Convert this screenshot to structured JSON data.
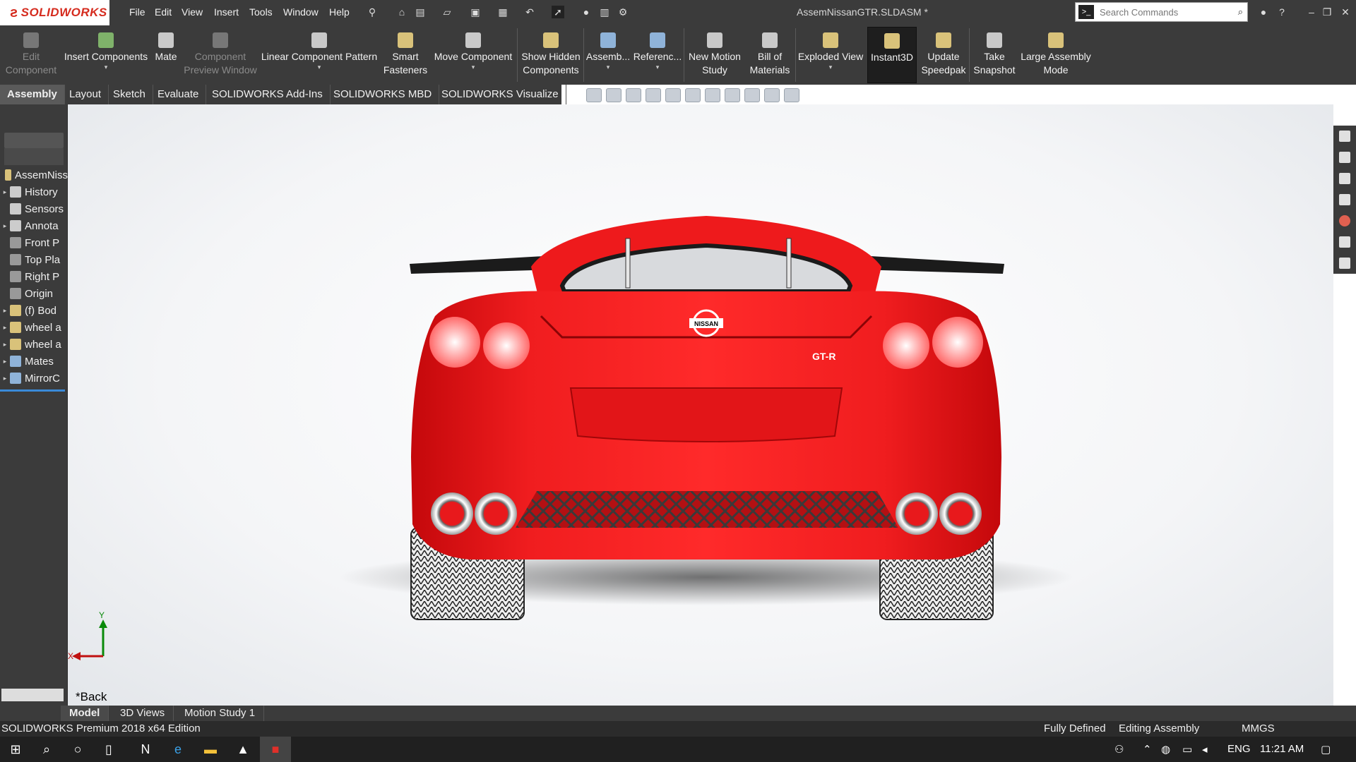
{
  "window": {
    "brand": "SOLIDWORKS",
    "doc_title": "AssemNissanGTR.SLDASM *",
    "menu": [
      "File",
      "Edit",
      "View",
      "Insert",
      "Tools",
      "Window",
      "Help"
    ],
    "search_placeholder": "Search Commands"
  },
  "ribbon": {
    "buttons": [
      {
        "label": "Edit\nComponent",
        "disabled": true,
        "icon": "edit-component-icon"
      },
      {
        "label": "Insert Components",
        "disabled": false,
        "icon": "insert-components-icon"
      },
      {
        "label": "Mate",
        "disabled": false,
        "icon": "mate-icon"
      },
      {
        "label": "Component\nPreview Window",
        "disabled": true,
        "icon": "preview-window-icon"
      },
      {
        "label": "Linear Component Pattern",
        "disabled": false,
        "icon": "linear-pattern-icon"
      },
      {
        "label": "Smart\nFasteners",
        "disabled": false,
        "icon": "smart-fasteners-icon"
      },
      {
        "label": "Move Component",
        "disabled": false,
        "icon": "move-component-icon"
      },
      {
        "label": "Show Hidden\nComponents",
        "disabled": false,
        "icon": "show-hidden-icon"
      },
      {
        "label": "Assemb...",
        "disabled": false,
        "icon": "assembly-features-icon"
      },
      {
        "label": "Referenc...",
        "disabled": false,
        "icon": "reference-geometry-icon"
      },
      {
        "label": "New Motion\nStudy",
        "disabled": false,
        "icon": "motion-study-icon"
      },
      {
        "label": "Bill of\nMaterials",
        "disabled": false,
        "icon": "bill-of-materials-icon"
      },
      {
        "label": "Exploded View",
        "disabled": false,
        "icon": "exploded-view-icon"
      },
      {
        "label": "Instant3D",
        "disabled": false,
        "icon": "instant3d-icon"
      },
      {
        "label": "Update\nSpeedpak",
        "disabled": false,
        "icon": "speedpak-icon"
      },
      {
        "label": "Take\nSnapshot",
        "disabled": false,
        "icon": "camera-icon"
      },
      {
        "label": "Large Assembly\nMode",
        "disabled": false,
        "icon": "large-assembly-icon"
      }
    ]
  },
  "tabs": [
    "Assembly",
    "Layout",
    "Sketch",
    "Evaluate",
    "SOLIDWORKS Add-Ins",
    "SOLIDWORKS MBD",
    "SOLIDWORKS Visualize"
  ],
  "active_tab": "Assembly",
  "tree": [
    {
      "label": "AssemNiss",
      "expand": false
    },
    {
      "label": "History",
      "expand": true
    },
    {
      "label": "Sensors",
      "expand": false
    },
    {
      "label": "Annota",
      "expand": true
    },
    {
      "label": "Front P",
      "expand": false
    },
    {
      "label": "Top Pla",
      "expand": false
    },
    {
      "label": "Right P",
      "expand": false
    },
    {
      "label": "Origin",
      "expand": false
    },
    {
      "label": "(f) Bod",
      "expand": true
    },
    {
      "label": "wheel a",
      "expand": true
    },
    {
      "label": "wheel a",
      "expand": true
    },
    {
      "label": "Mates",
      "expand": true
    },
    {
      "label": "MirrorC",
      "expand": true
    }
  ],
  "viewport": {
    "view_name": "*Back",
    "triad": {
      "x": "X",
      "y": "Y"
    },
    "badge_text": "NISSAN",
    "model_text": "GT-R"
  },
  "bottom_tabs": [
    "Model",
    "3D Views",
    "Motion Study 1"
  ],
  "status": {
    "edition": "SOLIDWORKS Premium 2018 x64 Edition",
    "defined": "Fully Defined",
    "mode": "Editing Assembly",
    "units": "MMGS"
  },
  "taskbar": {
    "lang": "ENG",
    "time": "11:21 AM"
  },
  "colors": {
    "car_red": "#e8191c",
    "ui_dark": "#3b3b3b",
    "brand_red": "#d52b1e"
  }
}
